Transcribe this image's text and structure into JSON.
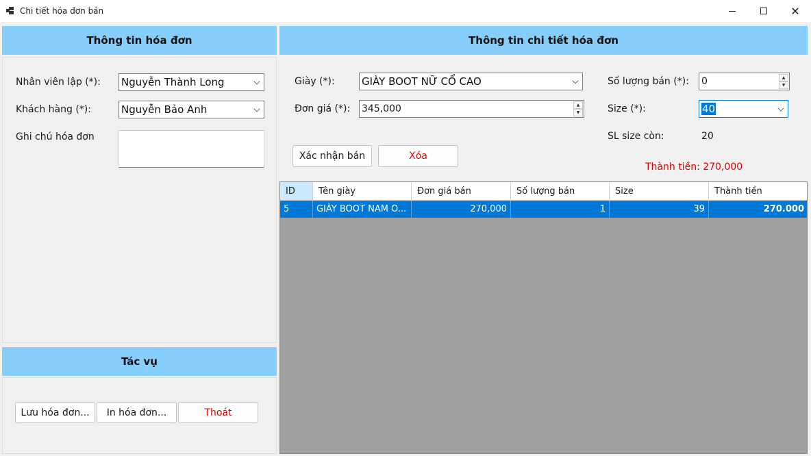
{
  "window": {
    "title": "Chi tiết hóa đơn bán"
  },
  "invoice_panel": {
    "header": "Thông tin hóa đơn",
    "employee_label": "Nhân viên lập (*):",
    "employee_value": "Nguyễn Thành Long",
    "customer_label": "Khách hàng (*):",
    "customer_value": "Nguyễn Bảo Anh",
    "note_label": "Ghi chú hóa đơn",
    "note_value": ""
  },
  "actions_panel": {
    "header": "Tác vụ",
    "save_label": "Lưu hóa đơn...",
    "print_label": "In hóa đơn...",
    "exit_label": "Thoát"
  },
  "detail_panel": {
    "header": "Thông tin chi tiết hóa đơn",
    "shoe_label": "Giày (*):",
    "shoe_value": "GIÀY BOOT NỮ CỔ CAO",
    "price_label": "Đơn giá (*):",
    "price_value": "345,000",
    "qty_label": "Số lượng bán (*):",
    "qty_value": "0",
    "size_label": "Size (*):",
    "size_value": "40",
    "size_left_label": "SL size còn:",
    "size_left_value": "20",
    "confirm_label": "Xác nhận bán",
    "delete_label": "Xóa",
    "total_text": "Thành tiền: 270,000"
  },
  "grid": {
    "columns": [
      "ID",
      "Tên giày",
      "Đơn giá bán",
      "Số lượng bán",
      "Size",
      "Thành tiền"
    ],
    "rows": [
      [
        "5",
        "GIÀY BOOT NAM O...",
        "270,000",
        "1",
        "39",
        "270.000"
      ]
    ]
  },
  "colors": {
    "header_bg": "#87cdfa",
    "selected_row": "#0078d7",
    "danger_text": "#e00000"
  }
}
